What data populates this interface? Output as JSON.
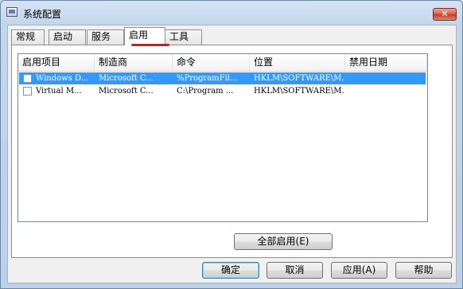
{
  "window": {
    "title": "系统配置"
  },
  "tabs": [
    {
      "label": "常规"
    },
    {
      "label": "启动"
    },
    {
      "label": "服务"
    },
    {
      "label": "启用"
    },
    {
      "label": "工具"
    }
  ],
  "active_tab": "启用",
  "table": {
    "columns": [
      "启用项目",
      "制造商",
      "命令",
      "位置",
      "禁用日期"
    ],
    "rows": [
      {
        "checked": false,
        "selected": true,
        "cells": [
          "Windows D...",
          "Microsoft C...",
          "%ProgramFil...",
          "HKLM\\SOFTWARE\\M...",
          ""
        ]
      },
      {
        "checked": false,
        "selected": false,
        "cells": [
          "Virtual M...",
          "Microsoft C...",
          "C:\\Program ...",
          "HKLM\\SOFTWARE\\M...",
          ""
        ]
      }
    ]
  },
  "buttons": {
    "enable_all": "全部启用(E)",
    "ok": "确定",
    "cancel": "取消",
    "apply": "应用(A)",
    "help": "帮助"
  },
  "colors": {
    "selection": "#3399ff",
    "tab_underline": "#d8161e",
    "close_button": "#c9432b"
  }
}
